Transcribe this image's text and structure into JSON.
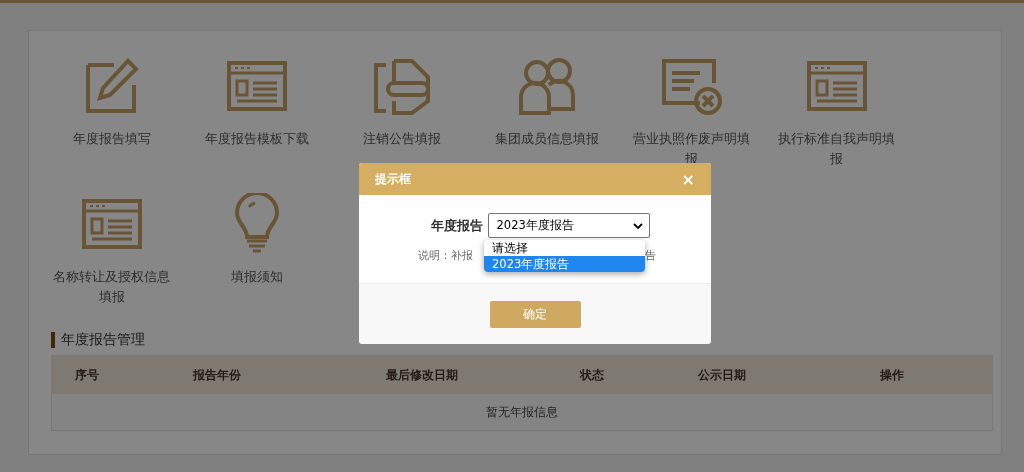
{
  "services": [
    {
      "label": "年度报告填写",
      "kind": "pencil"
    },
    {
      "label": "年度报告模板下载",
      "kind": "form"
    },
    {
      "label": "注销公告填报",
      "kind": "doc"
    },
    {
      "label": "集团成员信息填报",
      "kind": "people"
    },
    {
      "label": "营业执照作废声明填报",
      "kind": "cancel"
    },
    {
      "label": "执行标准自我声明填报",
      "kind": "form"
    },
    {
      "label": "名称转让及授权信息填报",
      "kind": "form"
    },
    {
      "label": "填报须知",
      "kind": "bulb"
    }
  ],
  "section_title": "年度报告管理",
  "table": {
    "columns": [
      "序号",
      "报告年份",
      "最后修改日期",
      "状态",
      "公示日期",
      "操作"
    ],
    "empty_text": "暂无年报信息"
  },
  "dialog": {
    "title": "提示框",
    "close": "×",
    "field_label": "年度报告",
    "select_value": "2023年度报告",
    "options": [
      {
        "label": "请选择",
        "selected": false
      },
      {
        "label": "2023年度报告",
        "selected": true
      }
    ],
    "note_start": "说明：补报",
    "note_end": "告",
    "confirm": "确定"
  }
}
